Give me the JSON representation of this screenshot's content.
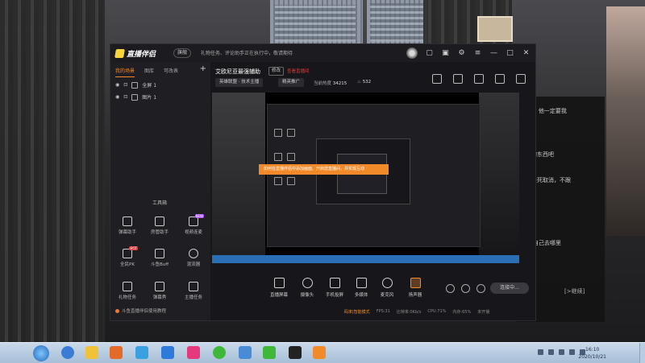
{
  "app": {
    "logo_text": "直播伴侣",
    "badge": "旗舰",
    "notice": "礼物任务、评论助手正在执行中，敬请期待"
  },
  "left_panel": {
    "tabs": [
      "我的场景",
      "图库",
      "可改表"
    ],
    "active_tab": 0,
    "add_label": "+",
    "sources": [
      "全屏 1",
      "图片 1"
    ],
    "toolbox_title": "工具箱",
    "tools": [
      {
        "label": "弹幕助手",
        "icon": "danmu-icon"
      },
      {
        "label": "房管助手",
        "icon": "room-manager-icon"
      },
      {
        "label": "视频连麦",
        "icon": "video-link-icon",
        "tag": "NEW"
      },
      {
        "label": "全民PK",
        "icon": "pk-icon",
        "tag": "HOT"
      },
      {
        "label": "斗鱼Buff",
        "icon": "buff-icon"
      },
      {
        "label": "混流器",
        "icon": "mixer-icon"
      },
      {
        "label": "礼物任务",
        "icon": "gift-task-icon"
      },
      {
        "label": "弹幕秀",
        "icon": "danmu-show-icon"
      },
      {
        "label": "主播任务",
        "icon": "anchor-task-icon"
      }
    ],
    "footer": "斗鱼直播伴侣使用教程"
  },
  "main": {
    "room_title": "艾欧尼亚最强辅助",
    "edit_label": "修改",
    "red_link": "查看直播间",
    "chips": [
      "英雄联盟 · 技术主播",
      "精英推广"
    ],
    "follow_label": "当前热度",
    "follow_value": "34215",
    "hot_value": "532",
    "preview_banner": "如何在直播伴侣中添加画面、开启您直播间，并实现互动"
  },
  "bottom_tools": [
    {
      "label": "直播屏幕",
      "icon": "screen-icon"
    },
    {
      "label": "摄像头",
      "icon": "camera-icon"
    },
    {
      "label": "手机投屏",
      "icon": "phone-cast-icon"
    },
    {
      "label": "多媒体",
      "icon": "media-icon"
    },
    {
      "label": "麦克风",
      "icon": "mic-icon"
    },
    {
      "label": "扬声器",
      "icon": "speaker-icon"
    }
  ],
  "live_button": "连接中...",
  "status_bar": {
    "mode": "码率|智能模式",
    "fps": "FPS:31",
    "bitrate": "比特率:0Kb/s",
    "cpu": "CPU:71%",
    "mem": "内存:65%",
    "network": "未开播"
  },
  "desktop_overlay": {
    "lines": [
      "了!你! 他一定要我",
      "我的东西吧",
      "我去死取消，不跟",
      "你自己去哪里"
    ],
    "continue_label": "[>继续]"
  },
  "taskbar": {
    "time": "16:10",
    "date": "2020/10/21"
  },
  "colors": {
    "accent": "#f28a2a",
    "danger": "#e23b3b",
    "window_bg": "#17171b",
    "taskbar": "#c9d9ea"
  }
}
